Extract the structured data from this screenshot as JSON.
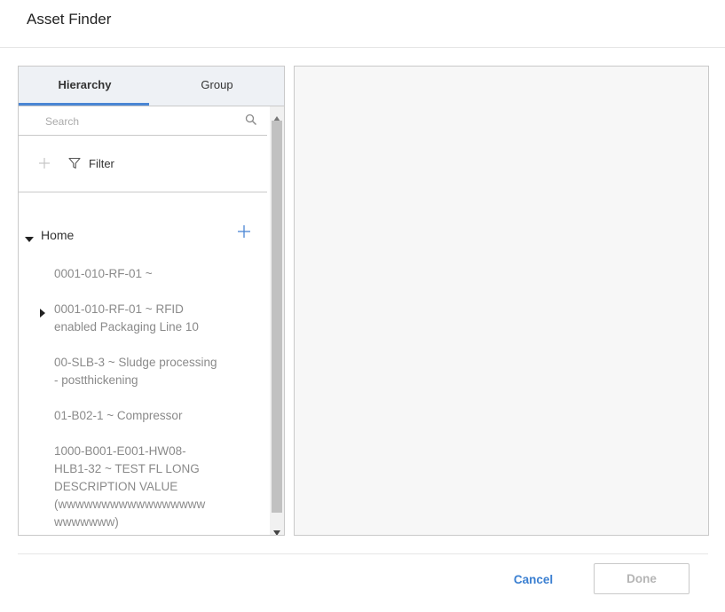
{
  "dialog": {
    "title": "Asset Finder"
  },
  "tabs": [
    {
      "label": "Hierarchy",
      "active": true
    },
    {
      "label": "Group",
      "active": false
    }
  ],
  "search": {
    "placeholder": "Search",
    "value": ""
  },
  "filter": {
    "label": "Filter"
  },
  "tree": {
    "root": {
      "label": "Home",
      "expanded": true
    },
    "nodes": [
      {
        "lines": [
          "0001-010-RF-01 ~"
        ],
        "expandable": false
      },
      {
        "lines": [
          "0001-010-RF-01 ~ RFID",
          "enabled Packaging Line 10"
        ],
        "expandable": true
      },
      {
        "lines": [
          "00-SLB-3 ~ Sludge processing",
          "- postthickening"
        ],
        "expandable": false
      },
      {
        "lines": [
          "01-B02-1 ~ Compressor"
        ],
        "expandable": false
      },
      {
        "lines": [
          "1000-B001-E001-HW08-",
          "HLB1-32 ~ TEST FL LONG",
          "DESCRIPTION VALUE",
          "(wwwwwwwwwwwwwwwww",
          "wwwwwww)"
        ],
        "expandable": false
      }
    ]
  },
  "footer": {
    "cancel_label": "Cancel",
    "done_label": "Done",
    "done_enabled": false
  },
  "colors": {
    "accent": "#4a86d4",
    "link": "#3a7fd1",
    "muted_text": "#8a8a8a",
    "border": "#c9c9c9"
  }
}
